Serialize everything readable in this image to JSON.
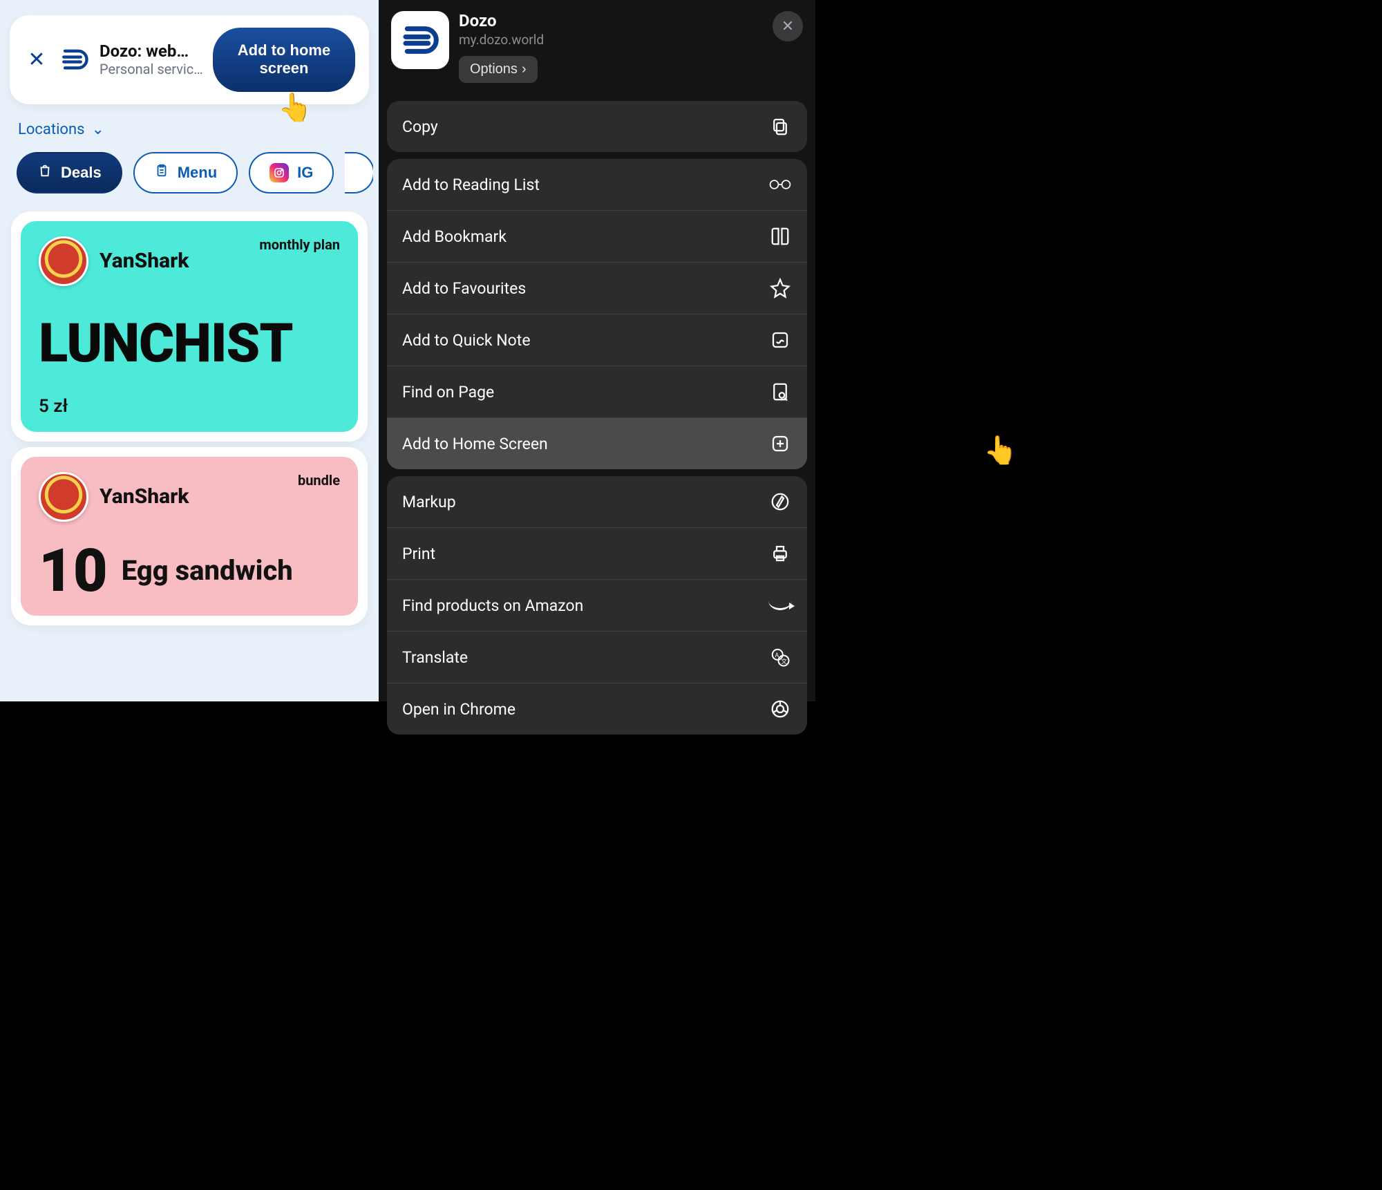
{
  "banner": {
    "title": "Dozo: web…",
    "subtitle": "Personal servic…",
    "button": "Add to home screen"
  },
  "filters": {
    "locations_label": "Locations",
    "chips": {
      "deals": "Deals",
      "menu": "Menu",
      "ig": "IG"
    }
  },
  "cards": [
    {
      "vendor": "YanShark",
      "tag": "monthly plan",
      "headline": "LUNCHIST",
      "price": "5 zł"
    },
    {
      "vendor": "YanShark",
      "tag": "bundle",
      "qty": "10",
      "item": "Egg sandwich"
    }
  ],
  "sheet": {
    "title": "Dozo",
    "url": "my.dozo.world",
    "options_label": "Options",
    "actions": {
      "copy": "Copy",
      "reading_list": "Add to Reading List",
      "bookmark": "Add Bookmark",
      "favourites": "Add to Favourites",
      "quick_note": "Add to Quick Note",
      "find_on_page": "Find on Page",
      "home_screen": "Add to Home Screen",
      "markup": "Markup",
      "print": "Print",
      "amazon": "Find products on Amazon",
      "translate": "Translate",
      "chrome": "Open in Chrome"
    }
  }
}
